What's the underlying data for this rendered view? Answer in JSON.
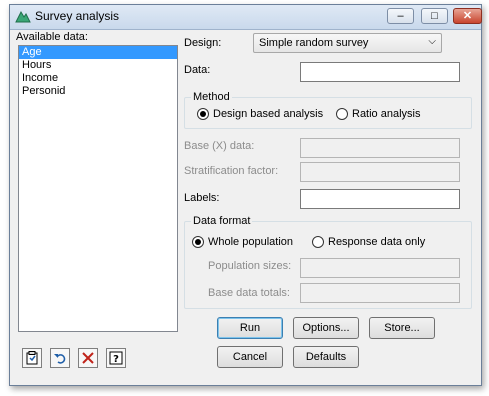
{
  "window": {
    "title": "Survey analysis"
  },
  "titlebar_buttons": {
    "minimize_icon": "minimize-icon",
    "maximize_icon": "maximize-icon",
    "close_icon": "close-icon"
  },
  "available": {
    "label": "Available data:",
    "items": [
      "Age",
      "Hours",
      "Income",
      "Personid"
    ],
    "selected": "Age"
  },
  "design": {
    "label": "Design:",
    "value": "Simple random survey"
  },
  "data_field": {
    "label": "Data:",
    "value": ""
  },
  "method": {
    "title": "Method",
    "options": [
      "Design based analysis",
      "Ratio analysis"
    ],
    "selected": "Design based analysis"
  },
  "base_data": {
    "label": "Base (X) data:",
    "value": ""
  },
  "stratification": {
    "label": "Stratification factor:",
    "value": ""
  },
  "labels": {
    "label": "Labels:",
    "value": ""
  },
  "data_format": {
    "title": "Data format",
    "options": [
      "Whole population",
      "Response data only"
    ],
    "selected": "Whole population",
    "population_sizes_label": "Population sizes:",
    "base_totals_label": "Base data totals:"
  },
  "buttons": {
    "run": "Run",
    "options": "Options...",
    "store": "Store...",
    "cancel": "Cancel",
    "defaults": "Defaults"
  },
  "toolbar_icons": [
    "clipboard-icon",
    "undo-icon",
    "clear-icon",
    "help-icon"
  ],
  "colors": {
    "selection": "#3399ff",
    "close_button": "#c8442e",
    "titlebar": "#c9d9ec"
  }
}
